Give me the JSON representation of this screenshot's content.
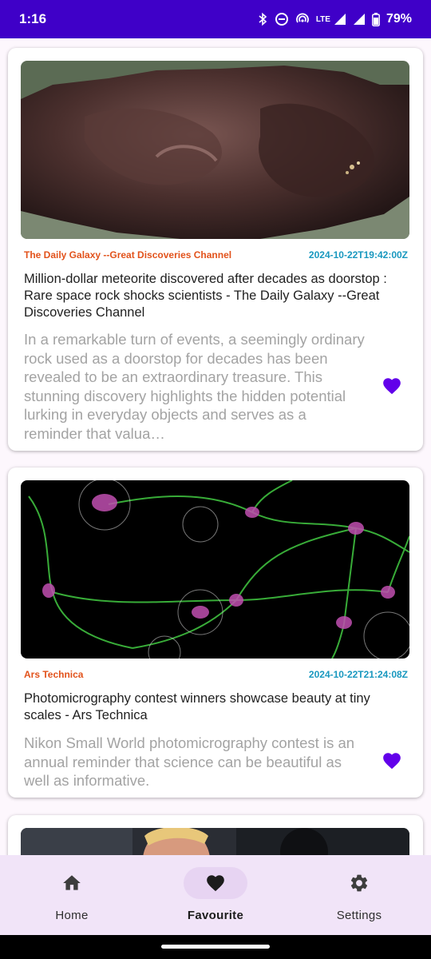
{
  "status_bar": {
    "time": "1:16",
    "network": "LTE",
    "battery": "79%",
    "background": "#3f00c8"
  },
  "articles": [
    {
      "source": "The Daily Galaxy --Great Discoveries Channel",
      "date": "2024-10-22T19:42:00Z",
      "title": "Million-dollar meteorite discovered after decades as doorstop : Rare space rock shocks scientists - The Daily Galaxy --Great Discoveries Channel",
      "description": "In a remarkable turn of events, a seemingly ordinary rock used as a doorstop for decades has been revealed to be an extraordinary treasure. This stunning discovery highlights the hidden potential lurking in everyday objects and serves as a reminder that valua…",
      "favourited": true
    },
    {
      "source": "Ars Technica",
      "date": "2024-10-22T21:24:08Z",
      "title": "Photomicrography contest winners showcase beauty at tiny scales - Ars Technica",
      "description": "Nikon Small World photomicrography contest is an annual reminder that science can be beautiful as well as informative.",
      "favourited": true
    }
  ],
  "nav": {
    "items": [
      {
        "label": "Home",
        "icon": "home-icon"
      },
      {
        "label": "Favourite",
        "icon": "heart-icon"
      },
      {
        "label": "Settings",
        "icon": "gear-icon"
      }
    ],
    "active": "Favourite"
  },
  "colors": {
    "source": "#e2521b",
    "date": "#1998bf",
    "favourite": "#6200ea",
    "nav_background": "#f1e4f8"
  }
}
